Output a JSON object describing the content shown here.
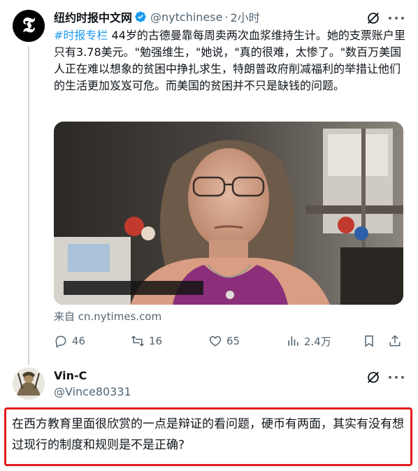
{
  "tweet": {
    "author_name": "纽约时报中文网",
    "handle": "@nytchinese",
    "separator": "·",
    "time": "2小时",
    "avatar_letter": "𝕿",
    "hashtag": "#时报专栏",
    "text": " 44岁的古德曼靠每周卖两次血浆维持生计。她的支票账户里只有3.78美元。\"勉强维生，\"她说，\"真的很难，太惨了。\"数百万美国人正在难以想象的贫困中挣扎求生，特朗普政府削减福利的举措让他们的生活更加岌岌可危。而美国的贫困并不只是缺钱的问题。",
    "source": "来自 cn.nytimes.com",
    "actions": {
      "replies": "46",
      "reposts": "16",
      "likes": "65",
      "views": "2.4万"
    },
    "icons": {
      "verified": "verified-badge-icon",
      "grok": "grok-icon",
      "more": "more-icon",
      "reply": "reply-icon",
      "repost": "repost-icon",
      "like": "like-icon",
      "views": "views-icon",
      "bookmark": "bookmark-icon",
      "share": "share-icon"
    }
  },
  "reply": {
    "author_name": "Vin-C",
    "handle": "@Vince80331",
    "text": "在西方教育里面很欣赏的一点是辩证的看问题，硬币有两面，其实有没有想过现行的制度和规则是不是正确?"
  },
  "colors": {
    "accent": "#1d9bf0",
    "secondary_text": "#536471",
    "highlight_border": "#e31b1b"
  }
}
